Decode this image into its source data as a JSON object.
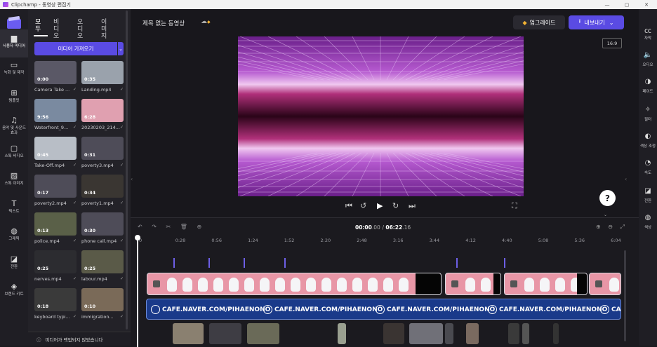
{
  "window": {
    "title": "Clipchamp - 동영상 편집기",
    "controls": [
      "—",
      "▢",
      "✕"
    ]
  },
  "left_rail": [
    {
      "label": "사용자 미디어",
      "icon": "folder-icon",
      "glyph": "▆",
      "active": true
    },
    {
      "label": "녹화 및 제작",
      "icon": "camera-icon",
      "glyph": "▭"
    },
    {
      "label": "템플릿",
      "icon": "template-icon",
      "glyph": "⊞"
    },
    {
      "label": "음악 및 사운드 효과",
      "icon": "music-icon",
      "glyph": "♫"
    },
    {
      "label": "스톡 비디오",
      "icon": "stock-video-icon",
      "glyph": "▢"
    },
    {
      "label": "스톡 이미지",
      "icon": "stock-image-icon",
      "glyph": "▨"
    },
    {
      "label": "텍스트",
      "icon": "text-icon",
      "glyph": "T"
    },
    {
      "label": "그래픽",
      "icon": "graphics-icon",
      "glyph": "◍"
    },
    {
      "label": "전환",
      "icon": "transition-icon",
      "glyph": "◪"
    },
    {
      "label": "브랜드 키트",
      "icon": "brand-kit-icon",
      "glyph": "◈"
    }
  ],
  "media_panel": {
    "tabs": [
      "모두",
      "비디오",
      "오디오",
      "이미지"
    ],
    "import_label": "미디어 가져오기",
    "items": [
      {
        "name": "Camera Take ...",
        "duration": "0:00",
        "color": "#5a5866"
      },
      {
        "name": "Landing.mp4",
        "duration": "0:35",
        "color": "#9aa2ac"
      },
      {
        "name": "Waterfront_9...",
        "duration": "9:56",
        "color": "#7a8aa0"
      },
      {
        "name": "20230203_214...",
        "duration": "6:28",
        "color": "#e0a0b0"
      },
      {
        "name": "Take-Off.mp4",
        "duration": "0:45",
        "color": "#b8bec6"
      },
      {
        "name": "poverty3.mp4",
        "duration": "0:31",
        "color": "#4e4c58"
      },
      {
        "name": "poverty2.mp4",
        "duration": "0:17",
        "color": "#4e4c58"
      },
      {
        "name": "poverty1.mp4",
        "duration": "0:34",
        "color": "#3a3632"
      },
      {
        "name": "police.mp4",
        "duration": "0:13",
        "color": "#5a6048"
      },
      {
        "name": "phone call.mp4",
        "duration": "0:30",
        "color": "#4e4c58"
      },
      {
        "name": "nerves.mp4",
        "duration": "0:25",
        "color": "#2c2c30"
      },
      {
        "name": "labour.mp4",
        "duration": "0:25",
        "color": "#5a5a48"
      },
      {
        "name": "keyboard typi...",
        "duration": "0:18",
        "color": "#3a3a3a"
      },
      {
        "name": "immigration...",
        "duration": "0:10",
        "color": "#7a6a58"
      }
    ],
    "backup_status": "미디어가 백업되지 않았습니다"
  },
  "header": {
    "project_title": "제목 없는 동영상",
    "upgrade_label": "업그레이드",
    "export_label": "내보내기",
    "aspect_ratio": "16:9"
  },
  "player": {
    "controls": [
      "⏮",
      "↺",
      "▶",
      "↻",
      "⏭"
    ],
    "fullscreen": "⛶",
    "help": "?"
  },
  "timeline": {
    "current_time": "00:00",
    "current_frac": ".00",
    "total_time": "06:22",
    "total_frac": ".16",
    "ruler": [
      "0",
      "0:28",
      "0:56",
      "1:24",
      "1:52",
      "2:20",
      "2:48",
      "3:16",
      "3:44",
      "4:12",
      "4:40",
      "5:08",
      "5:36",
      "6:04"
    ],
    "text_clip": "CAFE.NAVER.COM/PIHAENONO",
    "tools": [
      "↶",
      "↷",
      "✂",
      "🗑",
      "⊕"
    ],
    "zoom": [
      "⊕",
      "⊖",
      "⤢"
    ]
  },
  "right_rail": [
    {
      "label": "자막",
      "icon": "captions-icon",
      "glyph": "㏄"
    },
    {
      "label": "오디오",
      "icon": "audio-icon",
      "glyph": "🔈"
    },
    {
      "label": "페이드",
      "icon": "fade-icon",
      "glyph": "◑"
    },
    {
      "label": "필터",
      "icon": "filter-icon",
      "glyph": "✧"
    },
    {
      "label": "색상 조정",
      "icon": "color-adjust-icon",
      "glyph": "◐"
    },
    {
      "label": "속도",
      "icon": "speed-icon",
      "glyph": "◔"
    },
    {
      "label": "전환",
      "icon": "transition-icon",
      "glyph": "◪"
    },
    {
      "label": "색상",
      "icon": "color-icon",
      "glyph": "◍"
    }
  ],
  "colors": {
    "accent": "#5a4be3",
    "text_track": "#1a3a8a",
    "video_clip": "#e896a6"
  }
}
